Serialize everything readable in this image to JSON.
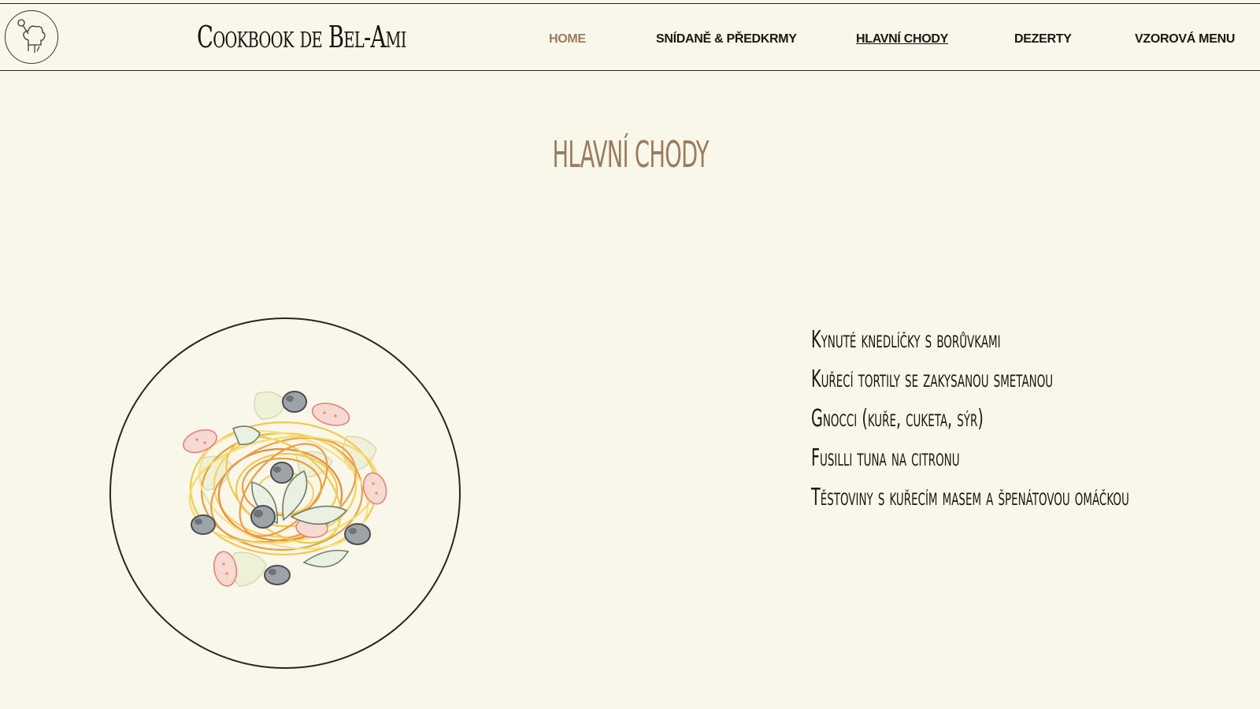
{
  "header": {
    "logo_icon": "chef-hat-icon",
    "brand": "Cookbook de Bel-Ami"
  },
  "nav": {
    "items": [
      {
        "label": "HOME",
        "state": "home"
      },
      {
        "label": "SNÍDANĚ & PŘEDKRMY",
        "state": "normal"
      },
      {
        "label": "HLAVNÍ CHODY",
        "state": "active"
      },
      {
        "label": "DEZERTY",
        "state": "normal"
      },
      {
        "label": "VZOROVÁ MENU",
        "state": "normal"
      }
    ]
  },
  "main": {
    "title": "HLAVNÍ CHODY",
    "illustration_icon": "pasta-plate-illustration",
    "recipes": [
      "Kynuté knedlíčky s borůvkami",
      "Kuřecí tortily se zakysanou smetanou",
      "Gnocci (kuře, cuketa, sýr)",
      "Fusilli tuna na citronu",
      "Těstoviny s kuřecím masem a špenátovou omáčkou"
    ]
  },
  "colors": {
    "background": "#f9f6ea",
    "accent": "#9c7a5e",
    "text": "#1c1712"
  }
}
